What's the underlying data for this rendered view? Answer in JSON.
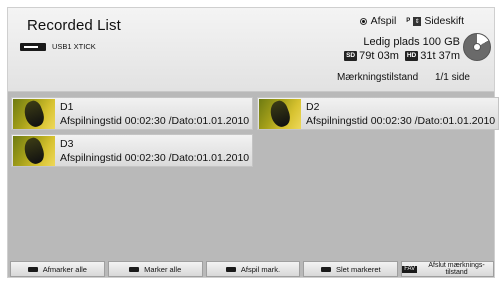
{
  "header": {
    "title": "Recorded List",
    "device_label": "USB1 XTICK",
    "device_icon": "usb-icon",
    "legend": {
      "play_label": "Afspil",
      "pageturn_key": "P",
      "pageturn_label": "Sideskift"
    },
    "free_space": "Ledig plads 100 GB",
    "sd_badge": "SD",
    "sd_time": "79t 03m",
    "hd_badge": "HD",
    "hd_time": "31t 37m",
    "mark_mode": "Mærkningstilstand",
    "page_info": "1/1 side"
  },
  "recordings": [
    {
      "title": "D1",
      "info": "Afspilningstid 00:02:30 /Dato:01.01.2010"
    },
    {
      "title": "D2",
      "info": "Afspilningstid 00:02:30 /Dato:01.01.2010"
    },
    {
      "title": "D3",
      "info": "Afspilningstid 00:02:30 /Dato:01.01.2010"
    }
  ],
  "buttons": {
    "unmark_all": "Afmarker alle",
    "mark_all": "Marker alle",
    "play_marked": "Afspil mark.",
    "delete_marked": "Slet markeret",
    "fav_key": "FAV",
    "exit_mark_mode": "Afslut mærknings-tilstand"
  },
  "colors": {
    "screen_bg": "#b9b9b9",
    "header_bg": "#e8e8e8",
    "key_black": "#1a1a1a"
  }
}
